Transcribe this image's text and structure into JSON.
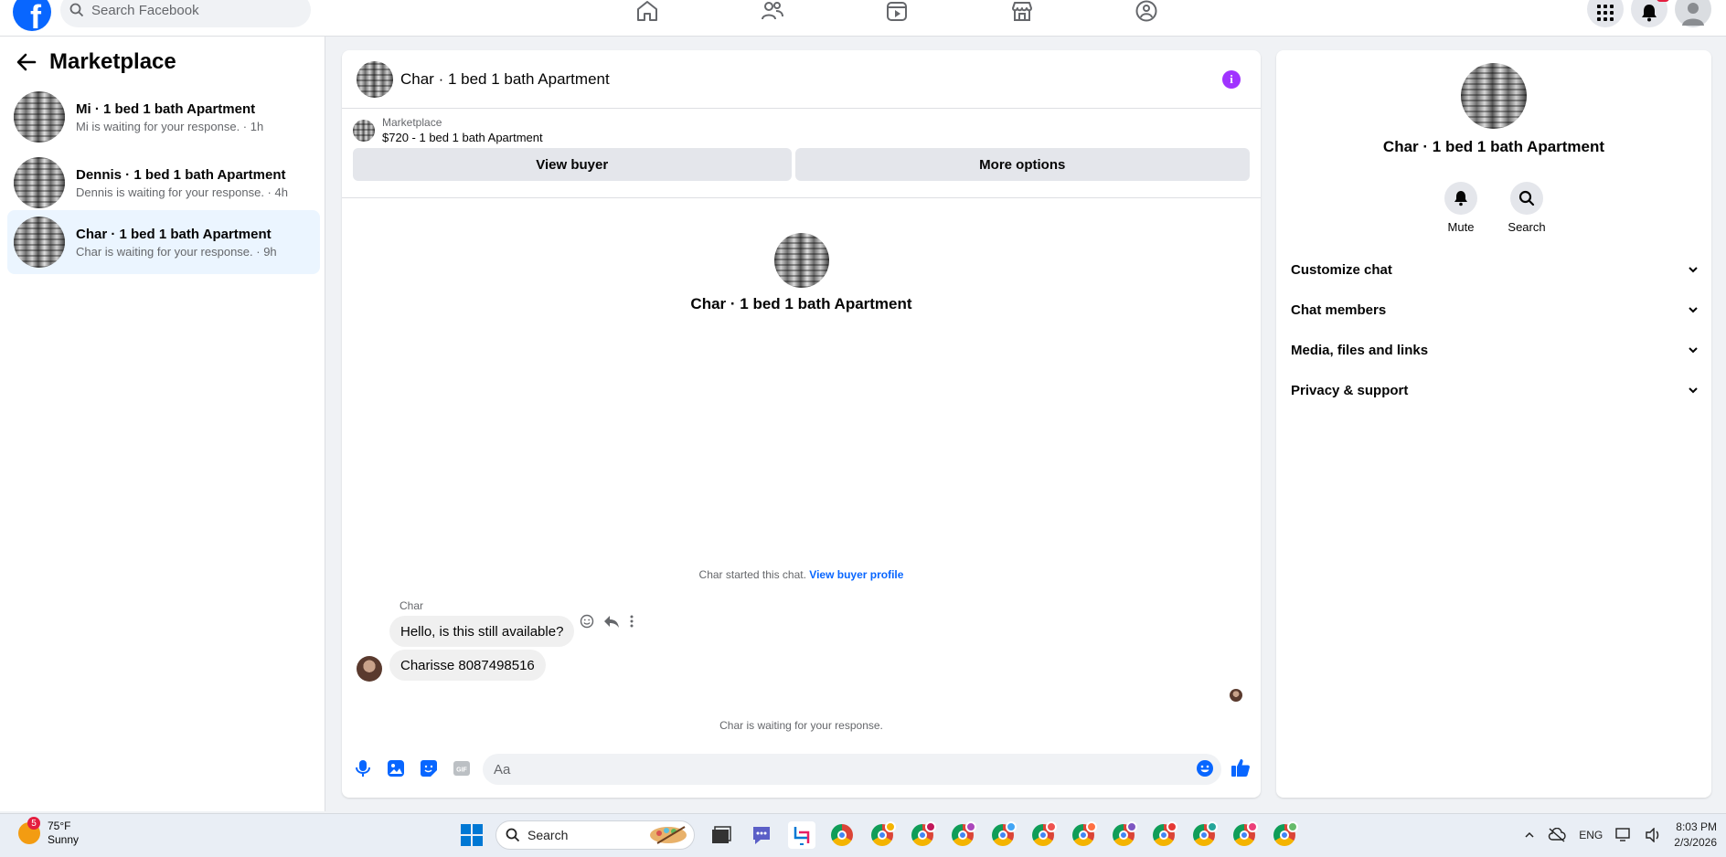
{
  "topbar": {
    "logo": "f",
    "search_placeholder": "Search Facebook",
    "nav_icons": [
      "home-icon",
      "friends-icon",
      "video-icon",
      "marketplace-icon",
      "groups-icon"
    ],
    "right_icons": [
      "menu-grid-icon",
      "notifications-icon",
      "account-icon"
    ]
  },
  "sidebar": {
    "title": "Marketplace",
    "conversations": [
      {
        "title": "Mi · 1 bed 1 bath Apartment",
        "subtitle": "Mi is waiting for your response. · 1h"
      },
      {
        "title": "Dennis · 1 bed 1 bath Apartment",
        "subtitle": "Dennis is waiting for your response. · 4h"
      },
      {
        "title": "Char · 1 bed 1 bath Apartment",
        "subtitle": "Char is waiting for your response. · 9h"
      }
    ]
  },
  "chat": {
    "header_name": "Char · 1 bed 1 bath Apartment",
    "info_glyph": "i",
    "listing_source": "Marketplace",
    "listing_detail": "$720 - 1 bed 1 bath Apartment",
    "view_buyer": "View buyer",
    "more_options": "More options",
    "intro_name": "Char · 1 bed 1 bath Apartment",
    "started_text": "Char started this chat.",
    "view_buyer_profile": "View buyer profile",
    "sender": "Char",
    "messages": [
      "Hello, is this still available?",
      "Charisse 8087498516"
    ],
    "waiting_text": "Char is waiting for your response.",
    "input_placeholder": "Aa",
    "accent": "#0866ff",
    "info_color": "#a033ff"
  },
  "details": {
    "name": "Char · 1 bed 1 bath Apartment",
    "actions": [
      {
        "label": "Mute",
        "icon": "bell-icon"
      },
      {
        "label": "Search",
        "icon": "search-icon"
      }
    ],
    "sections": [
      "Customize chat",
      "Chat members",
      "Media, files and links",
      "Privacy & support"
    ]
  },
  "taskbar": {
    "weather_badge": "5",
    "temperature": "75°F",
    "condition": "Sunny",
    "search_label": "Search",
    "language": "ENG",
    "time": "8:03 PM",
    "date": "2/3/2026"
  }
}
